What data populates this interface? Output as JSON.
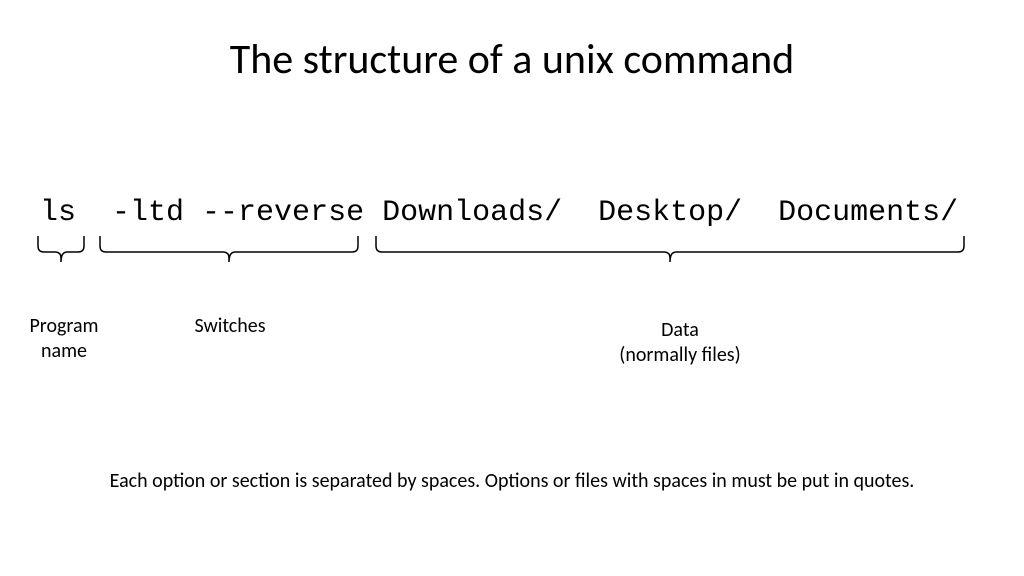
{
  "title": "The structure of a unix command",
  "command": {
    "program": "ls",
    "switches": "-ltd --reverse",
    "data": "Downloads/  Desktop/  Documents/"
  },
  "labels": {
    "program": "Program\nname",
    "switches": "Switches",
    "data": "Data\n(normally files)"
  },
  "footnote": "Each option or section is separated by spaces.  Options or files with spaces in must be put in quotes."
}
